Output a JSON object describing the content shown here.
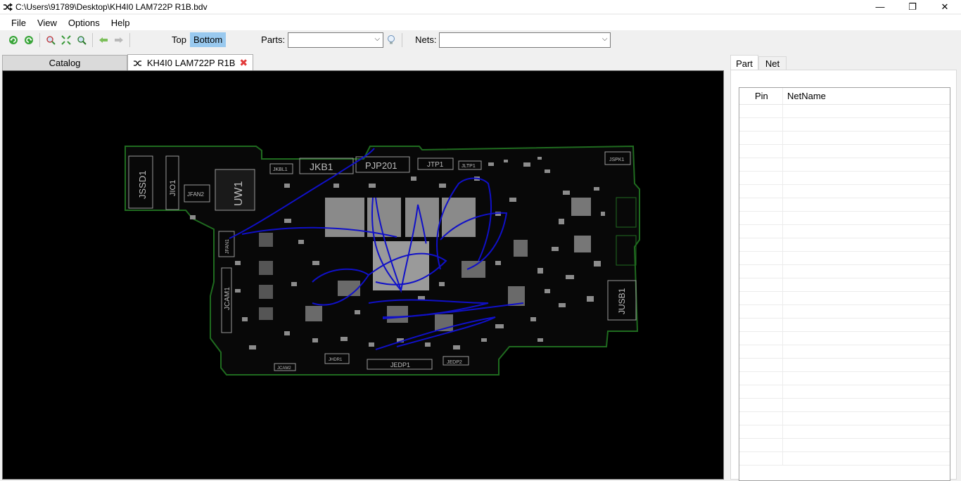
{
  "window": {
    "title": "C:\\Users\\91789\\Desktop\\KH4I0 LAM722P R1B.bdv",
    "minimize": "—",
    "restore": "❐",
    "close": "✕"
  },
  "menu": {
    "file": "File",
    "view": "View",
    "options": "Options",
    "help": "Help"
  },
  "toolbar": {
    "icons": [
      "rotate-left-icon",
      "rotate-right-icon",
      "zoom-icon",
      "fit-icon",
      "zoom-select-icon",
      "back-arrow-icon",
      "forward-arrow-icon"
    ],
    "top_label": "Top",
    "bottom_label": "Bottom",
    "active_view": "Bottom",
    "parts_label": "Parts:",
    "parts_value": "",
    "nets_label": "Nets:",
    "nets_value": ""
  },
  "tabs": {
    "catalog": "Catalog",
    "document": "KH4I0 LAM722P R1B",
    "close_glyph": "✖"
  },
  "board": {
    "labels": {
      "jssd1": "JSSD1",
      "jio1": "JIO1",
      "jfan2": "JFAN2",
      "uw1": "UW1",
      "jkbl1": "JKBL1",
      "jkb1": "JKB1",
      "pjp201": "PJP201",
      "jtp1": "JTP1",
      "jltp1": "JLTP1",
      "jspk1": "JSPK1",
      "jfan1": "JFAN1",
      "jcam1": "JCAM1",
      "jusb1": "JUSB1",
      "jedp1": "JEDP1",
      "jedp2": "JEDP2",
      "jcam2": "JCAM2",
      "jhdr1": "JHDR1"
    },
    "colors": {
      "outline": "#1f6b1f",
      "trace": "#1010c8",
      "label": "#bdbdbd"
    }
  },
  "right_panel": {
    "tab_part": "Part",
    "tab_net": "Net",
    "col_pin": "Pin",
    "col_netname": "NetName"
  }
}
